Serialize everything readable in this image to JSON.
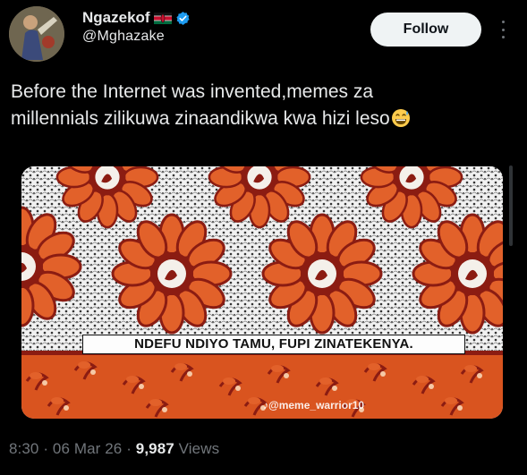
{
  "author": {
    "display_name": "Ngazekof",
    "handle": "@Mghazake",
    "flag_icon": "kenya-flag-icon",
    "verified_icon": "verified-badge-icon"
  },
  "actions": {
    "follow_label": "Follow",
    "more_icon": "more-vertical-icon"
  },
  "tweet": {
    "text_line_1": "Before the Internet was invented,memes za",
    "text_line_2": "millennials zilikuwa zinaandikwa kwa hizi leso",
    "emoji": "grinning-sweat-emoji"
  },
  "media": {
    "caption": "NDEFU NDIYO TAMU, FUPI ZINATEKENYA.",
    "watermark": "♪@meme_warrior10"
  },
  "meta": {
    "time": "8:30",
    "separator": "·",
    "date": "06 Mar 26",
    "views_count": "9,987",
    "views_label": "Views"
  },
  "colors": {
    "background": "#000000",
    "text": "#e7e9ea",
    "muted": "#71767b",
    "verified": "#1d9bf0",
    "fabric_red": "#8b1c12",
    "fabric_orange": "#e2612a"
  }
}
